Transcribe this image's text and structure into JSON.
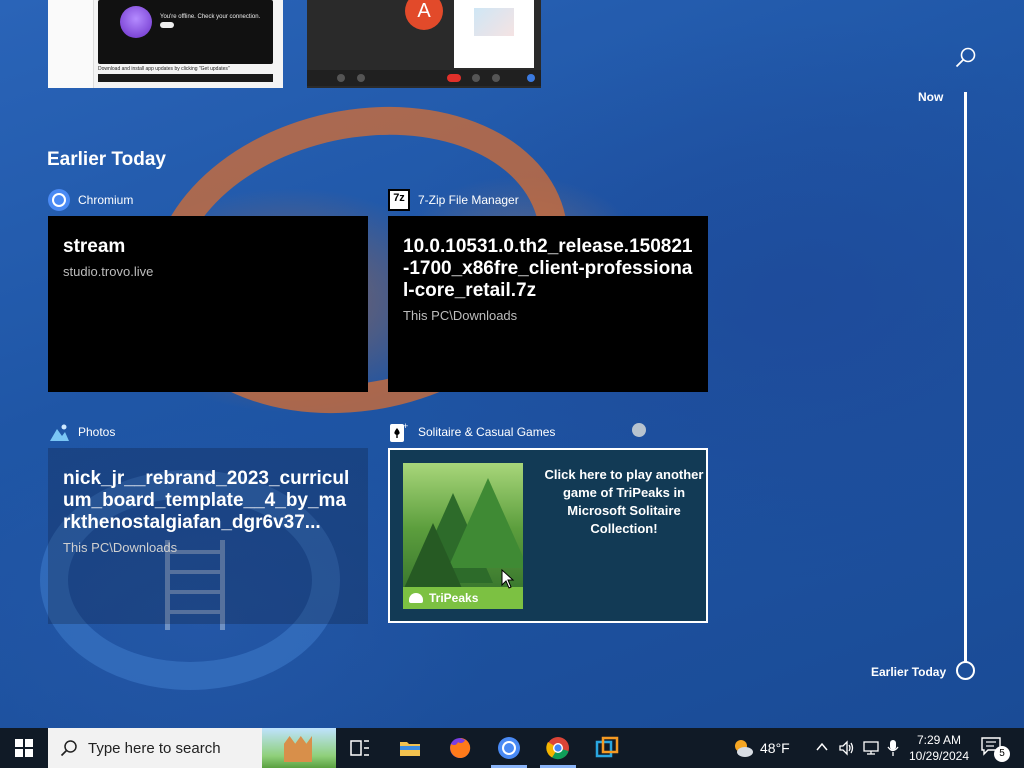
{
  "top_thumbnails": {
    "first": {
      "offline_message": "You're offline. Check your connection.",
      "caption": "Download and install app updates by clicking \"Get updates\""
    },
    "second": {
      "avatar_letter": "A"
    }
  },
  "timeline": {
    "now_label": "Now",
    "earlier_label": "Earlier Today"
  },
  "section": {
    "title": "Earlier Today"
  },
  "activities": [
    {
      "app": "Chromium",
      "title": "stream",
      "subtitle": "studio.trovo.live"
    },
    {
      "app": "7-Zip File Manager",
      "app_icon_text": "7z",
      "title": "10.0.10531.0.th2_release.150821-1700_x86fre_client-professional-core_retail.7z",
      "subtitle": "This PC\\Downloads"
    },
    {
      "app": "Photos",
      "title": "nick_jr__rebrand_2023_curriculum_board_template__4_by_markthenostalgiafan_dgr6v37...",
      "subtitle": "This PC\\Downloads"
    },
    {
      "app": "Solitaire & Casual Games",
      "tile_label": "TriPeaks",
      "promo": "Click here to play another game of TriPeaks in Microsoft Solitaire Collection!"
    }
  ],
  "taskbar": {
    "search_placeholder": "Type here to search",
    "weather_temp": "48°F",
    "time": "7:29 AM",
    "date": "10/29/2024",
    "notification_count": "5"
  },
  "colors": {
    "taskbar_bg": "#101a26",
    "card_bg": "#000000",
    "tripeaks_green": "#7cc142",
    "chrome_blue": "#8ab4f8"
  }
}
